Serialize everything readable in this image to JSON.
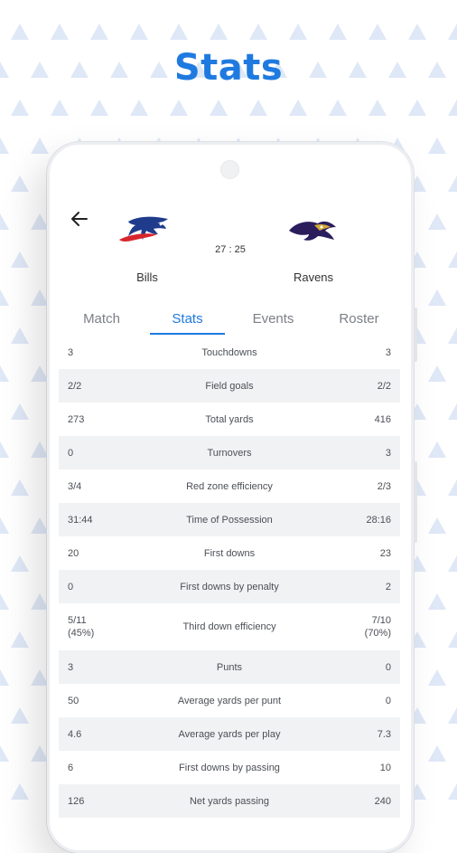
{
  "headline": "Stats",
  "match": {
    "home_team": "Bills",
    "away_team": "Ravens",
    "score": "27 : 25"
  },
  "tabs": [
    "Match",
    "Stats",
    "Events",
    "Roster"
  ],
  "active_tab": "Stats",
  "stats": [
    {
      "home": "3",
      "label": "Touchdowns",
      "away": "3"
    },
    {
      "home": "2/2",
      "label": "Field goals",
      "away": "2/2"
    },
    {
      "home": "273",
      "label": "Total yards",
      "away": "416"
    },
    {
      "home": "0",
      "label": "Turnovers",
      "away": "3"
    },
    {
      "home": "3/4",
      "label": "Red zone efficiency",
      "away": "2/3"
    },
    {
      "home": "31:44",
      "label": "Time of Possession",
      "away": "28:16"
    },
    {
      "home": "20",
      "label": "First downs",
      "away": "23"
    },
    {
      "home": "0",
      "label": "First downs by penalty",
      "away": "2"
    },
    {
      "home": "5/11\n(45%)",
      "label": "Third down efficiency",
      "away": "7/10\n(70%)"
    },
    {
      "home": "3",
      "label": "Punts",
      "away": "0"
    },
    {
      "home": "50",
      "label": "Average yards per punt",
      "away": "0"
    },
    {
      "home": "4.6",
      "label": "Average yards per play",
      "away": "7.3"
    },
    {
      "home": "6",
      "label": "First downs by passing",
      "away": "10"
    },
    {
      "home": "126",
      "label": "Net yards passing",
      "away": "240"
    }
  ],
  "colors": {
    "accent": "#1f7ae0",
    "pattern": "#dfe8f7",
    "row_shade": "#f1f2f4"
  },
  "icons": {
    "back": "arrow-left-icon",
    "home_logo": "bills-logo",
    "away_logo": "ravens-logo"
  }
}
